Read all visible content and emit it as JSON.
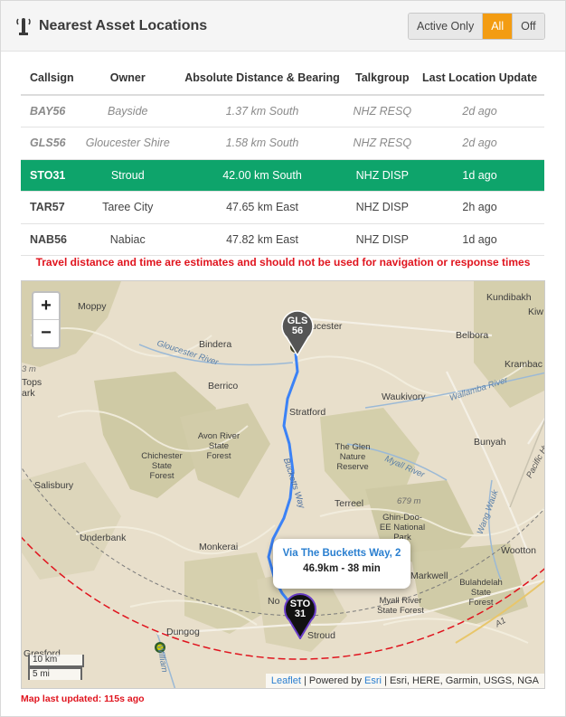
{
  "header": {
    "title": "Nearest Asset Locations",
    "icon": "tower-icon",
    "filters": [
      {
        "label": "Active Only",
        "active": false
      },
      {
        "label": "All",
        "active": true
      },
      {
        "label": "Off",
        "active": false
      }
    ]
  },
  "table": {
    "columns": [
      "Callsign",
      "Owner",
      "Absolute Distance & Bearing",
      "Talkgroup",
      "Last Location Update"
    ],
    "rows": [
      {
        "callsign": "BAY56",
        "owner": "Bayside",
        "distance": "1.37 km South",
        "talkgroup": "NHZ RESQ",
        "updated": "2d ago",
        "state": "muted"
      },
      {
        "callsign": "GLS56",
        "owner": "Gloucester Shire",
        "distance": "1.58 km South",
        "talkgroup": "NHZ RESQ",
        "updated": "2d ago",
        "state": "muted"
      },
      {
        "callsign": "STO31",
        "owner": "Stroud",
        "distance": "42.00 km South",
        "talkgroup": "NHZ DISP",
        "updated": "1d ago",
        "state": "selected"
      },
      {
        "callsign": "TAR57",
        "owner": "Taree City",
        "distance": "47.65 km East",
        "talkgroup": "NHZ DISP",
        "updated": "2h ago",
        "state": "normal"
      },
      {
        "callsign": "NAB56",
        "owner": "Nabiac",
        "distance": "47.82 km East",
        "talkgroup": "NHZ DISP",
        "updated": "1d ago",
        "state": "normal"
      }
    ]
  },
  "warning": "Travel distance and time are estimates and should not be used for navigation or response times",
  "map": {
    "zoom_in": "+",
    "zoom_out": "−",
    "places": {
      "moppy": "Moppy",
      "bindera": "Bindera",
      "gloucester": "ucester",
      "kundibakh": "Kundibakh",
      "belbora": "Belbora",
      "krambach": "Krambac",
      "berrico": "Berrico",
      "waukivory": "Waukivory",
      "stratford": "Stratford",
      "bunyah": "Bunyah",
      "avon1": "Avon River",
      "avon2": "State",
      "avon3": "Forest",
      "chich1": "Chichester",
      "chich2": "State",
      "chich3": "Forest",
      "glen1": "The Glen",
      "glen2": "Nature",
      "glen3": "Reserve",
      "salisbury": "Salisbury",
      "terreel": "Terreel",
      "ghin1": "Ghin-Doo-",
      "ghin2": "EE National",
      "ghin3": "Park",
      "underbank": "Underbank",
      "monkerai": "Monkerai",
      "wootton": "Wootton",
      "markwell": "Markwell",
      "bul1": "Bulahdelah",
      "bul2": "State",
      "bul3": "Forest",
      "myall1": "Myall River",
      "myall2": "State Forest",
      "stroud": "Stroud",
      "dungog": "Dungog",
      "gresford": "Gresford",
      "no": "No",
      "kiw": "Kiw",
      "tops1": "Tops",
      "tops2": "ark",
      "m3": "3 m",
      "elev": "679 m"
    },
    "rivers": {
      "gloucester_river": "Gloucester River",
      "wallamba": "Wallamba River",
      "myall": "Myall River",
      "bucketts": "Bucketts Way",
      "pacific": "Pacific Hwy",
      "wang": "Wang Wauk",
      "a1": "A1",
      "williams": "William"
    },
    "markers": [
      {
        "id": "GLS56",
        "line1": "GLS",
        "line2": "56",
        "color": "#555555"
      },
      {
        "id": "STO31",
        "line1": "STO",
        "line2": "31",
        "color": "#111111"
      }
    ],
    "route_color": "#3b82f6",
    "radius_color": "#e0141e",
    "popup": {
      "route": "Via The Bucketts Way, 2",
      "summary": "46.9km - 38 min"
    },
    "scale": {
      "metric": "10 km",
      "imperial": "5 mi"
    },
    "attribution": {
      "leaflet": "Leaflet",
      "sep1": " | Powered by ",
      "esri": "Esri",
      "rest": " | Esri, HERE, Garmin, USGS, NGA"
    }
  },
  "footer": "Map last updated: 115s ago"
}
